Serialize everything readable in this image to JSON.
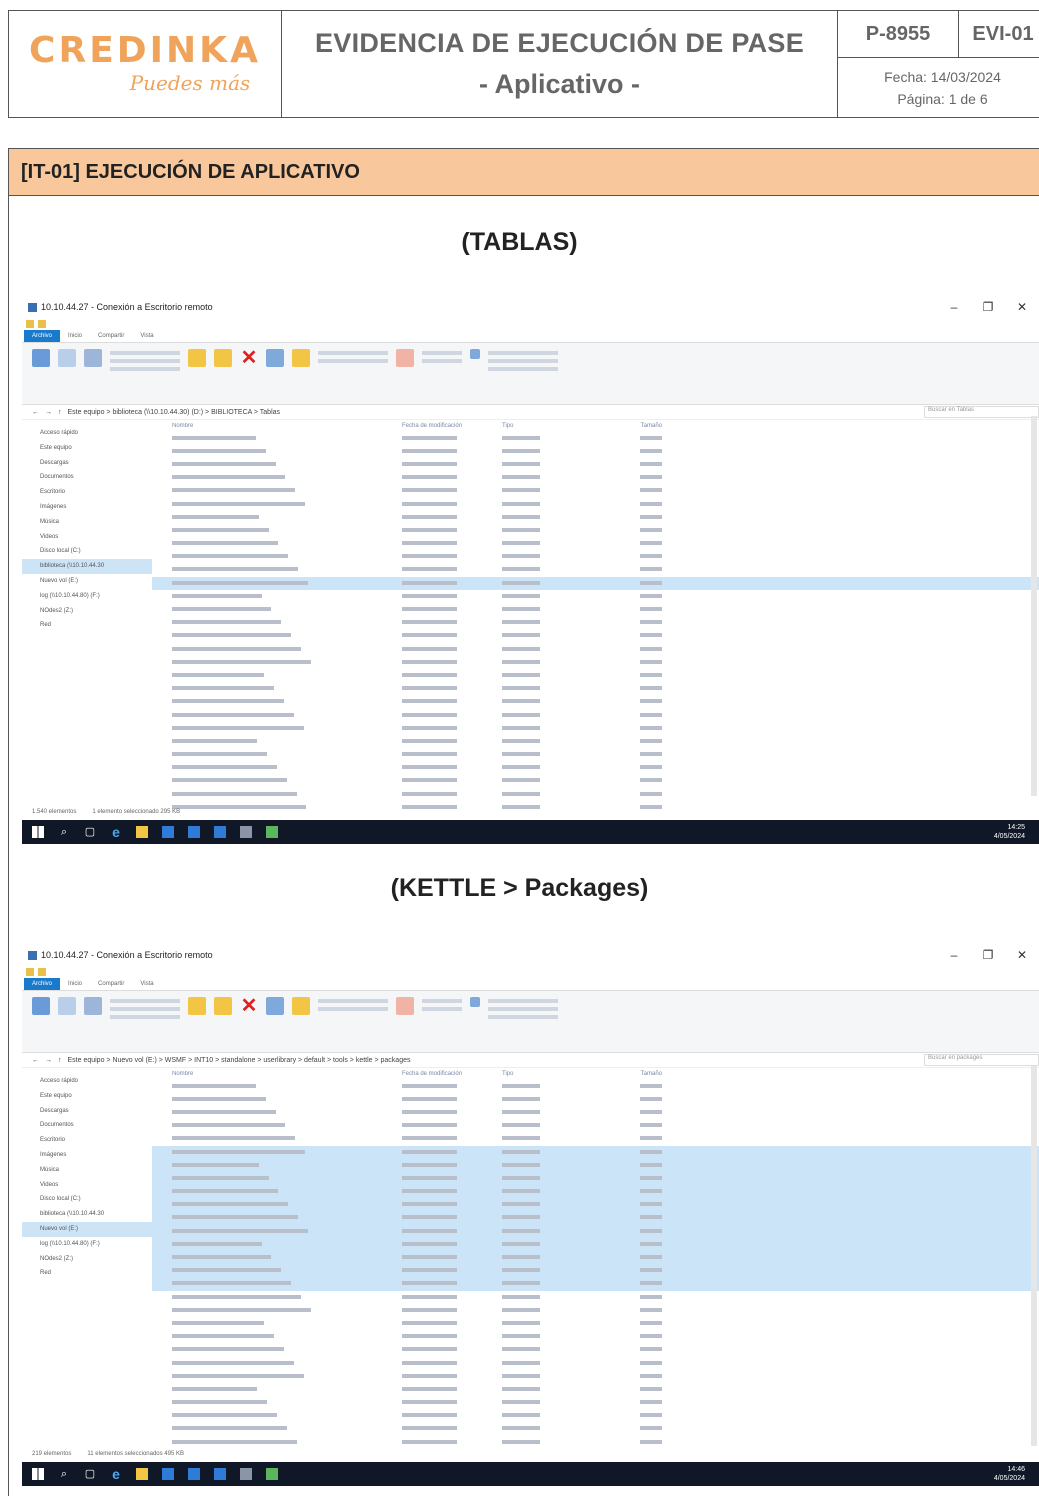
{
  "header": {
    "logo_text": "CREDINKA",
    "logo_tagline": "Puedes más",
    "title_line1": "EVIDENCIA DE EJECUCIÓN DE PASE",
    "title_line2": "- Aplicativo -",
    "code_left": "P-8955",
    "code_right": "EVI-01",
    "date_label": "Fecha: 14/03/2024",
    "page_label": "Página: 1 de 6"
  },
  "section": {
    "title": "[IT-01]  EJECUCIÓN DE APLICATIVO",
    "caption1": "(TABLAS)",
    "caption2": "(KETTLE > Packages)"
  },
  "colors": {
    "section_bg": "#f8c89c",
    "logo": "#f0a35a",
    "selection": "#cce4f7",
    "taskbar": "#101827"
  },
  "screenshot1": {
    "window_title": "10.10.44.27 - Conexión a Escritorio remoto",
    "tabs": [
      "Archivo",
      "Inicio",
      "Compartir",
      "Vista"
    ],
    "address": "Este equipo  >  biblioteca (\\\\10.10.44.30) (D:)  >  BIBLIOTECA  >  Tablas",
    "search_placeholder": "Buscar en Tablas",
    "columns": [
      "Nombre",
      "Fecha de modificación",
      "Tipo",
      "Tamaño"
    ],
    "nav": [
      "Acceso rápido",
      "Este equipo",
      "Descargas",
      "Documentos",
      "Escritorio",
      "Imágenes",
      "Música",
      "Videos",
      "Disco local (C:)",
      "biblioteca (\\\\10.10.44.30",
      "Nuevo vol (E:)",
      "log (\\\\10.10.44.80) (F:)",
      "NOdes2 (Z:)",
      "Red"
    ],
    "status": [
      "1.540 elementos",
      "1 elemento seleccionado  295 KB"
    ],
    "tray_time": "14:25",
    "tray_date": "4/05/2024"
  },
  "screenshot2": {
    "window_title": "10.10.44.27 - Conexión a Escritorio remoto",
    "tabs": [
      "Archivo",
      "Inicio",
      "Compartir",
      "Vista"
    ],
    "address": "Este equipo  >  Nuevo vol (E:)  >  WSMF  >  INT10  >  standalone  >  userlibrary  >  default  >  tools  >  kettle  >  packages",
    "search_placeholder": "Buscar en packages",
    "columns": [
      "Nombre",
      "Fecha de modificación",
      "Tipo",
      "Tamaño"
    ],
    "nav": [
      "Acceso rápido",
      "Este equipo",
      "Descargas",
      "Documentos",
      "Escritorio",
      "Imágenes",
      "Música",
      "Videos",
      "Disco local (C:)",
      "biblioteca (\\\\10.10.44.30",
      "Nuevo vol (E:)",
      "log (\\\\10.10.44.80) (F:)",
      "NOdes2 (Z:)",
      "Red"
    ],
    "status": [
      "219 elementos",
      "11 elementos seleccionados  495 KB"
    ],
    "tray_time": "14:46",
    "tray_date": "4/05/2024"
  }
}
